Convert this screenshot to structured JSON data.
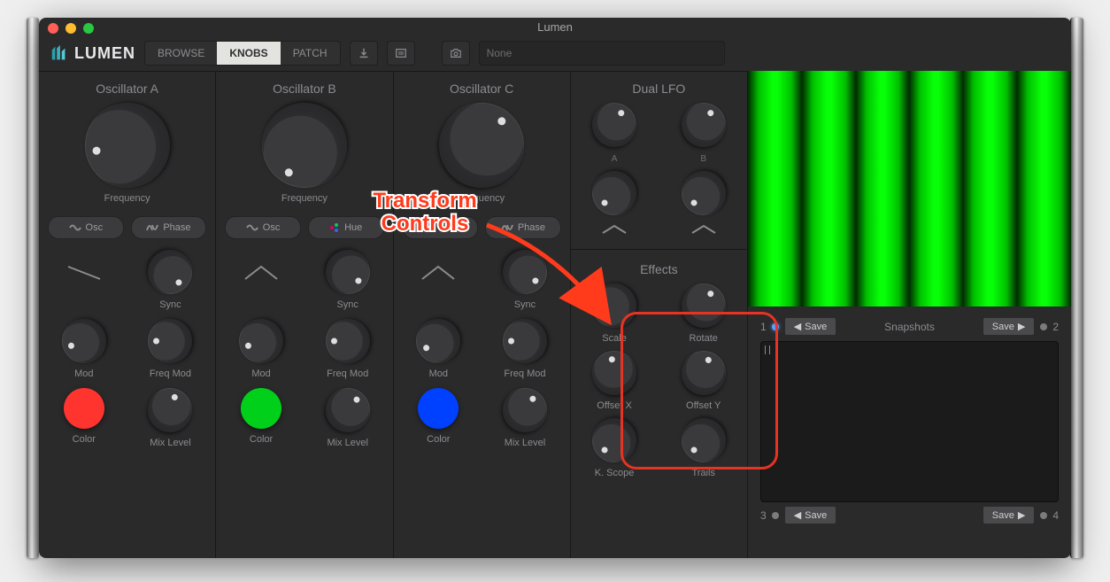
{
  "window_title": "Lumen",
  "brand": "LUMEN",
  "tabs": {
    "browse": "BROWSE",
    "knobs": "KNOBS",
    "patch": "PATCH",
    "active": "knobs"
  },
  "search_placeholder": "None",
  "oscillators": {
    "a": {
      "title": "Oscillator A",
      "freq_label": "Frequency",
      "pills": [
        "Osc",
        "Phase"
      ],
      "shape": "saw",
      "grid": [
        "",
        "Sync",
        "Mod",
        "Freq Mod",
        "Color",
        "Mix Level"
      ],
      "color": "#ff342e"
    },
    "b": {
      "title": "Oscillator B",
      "freq_label": "Frequency",
      "pills": [
        "Osc",
        "Hue"
      ],
      "shape": "tri",
      "grid": [
        "",
        "Sync",
        "Mod",
        "Freq Mod",
        "Color",
        "Mix Level"
      ],
      "color": "#00d01a"
    },
    "c": {
      "title": "Oscillator C",
      "freq_label": "Frequency",
      "pills": [
        "Osc",
        "Phase"
      ],
      "shape": "tri",
      "grid": [
        "",
        "Sync",
        "Mod",
        "Freq Mod",
        "Color",
        "Mix Level"
      ],
      "color": "#0040ff"
    }
  },
  "dual_lfo": {
    "title": "Dual LFO",
    "a": "A",
    "b": "B"
  },
  "effects": {
    "title": "Effects",
    "scale": "Scale",
    "rotate": "Rotate",
    "offset_x": "Offset X",
    "offset_y": "Offset Y",
    "kscope": "K. Scope",
    "trails": "Trails"
  },
  "snapshots": {
    "title": "Snapshots",
    "save_left": "Save",
    "save_right": "Save",
    "save_bl": "Save",
    "save_br": "Save",
    "n1": "1",
    "n2": "2",
    "n3": "3",
    "n4": "4"
  },
  "annotation": {
    "line1": "Transform",
    "line2": "Controls"
  },
  "colors": {
    "accent_tab": "#e3e3e0",
    "orange": "#ff3b1c",
    "highlight": "#e63323",
    "green_bars": "#07ff07"
  }
}
